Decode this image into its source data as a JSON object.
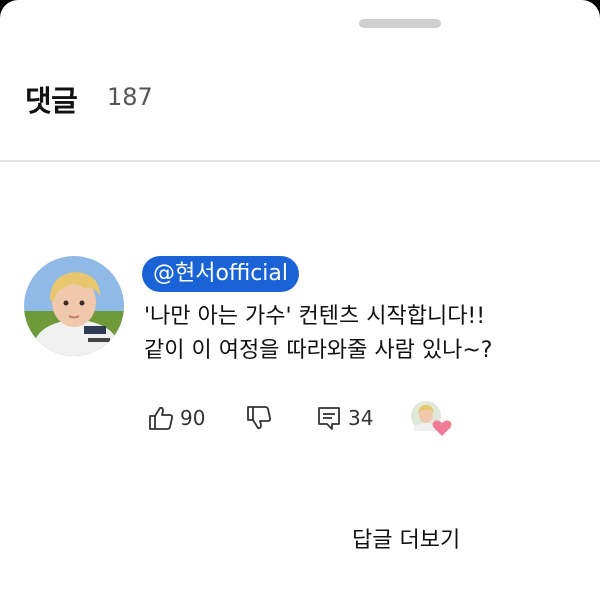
{
  "header": {
    "title": "댓글",
    "count": "187"
  },
  "comment": {
    "author": "@현서official",
    "lines": [
      "'나만 아는 가수' 컨텐츠 시작합니다!!",
      "같이 이 여정을 따라와줄 사람 있나~?"
    ],
    "likes": "90",
    "replies": "34",
    "author_chip_color": "#1a63d6",
    "heart_color": "#f07b95"
  },
  "more_replies_label": "답글 더보기",
  "icons": {
    "like": "thumbs-up-icon",
    "dislike": "thumbs-down-icon",
    "reply": "reply-comment-icon",
    "creator_heart": "creator-heart-icon"
  }
}
